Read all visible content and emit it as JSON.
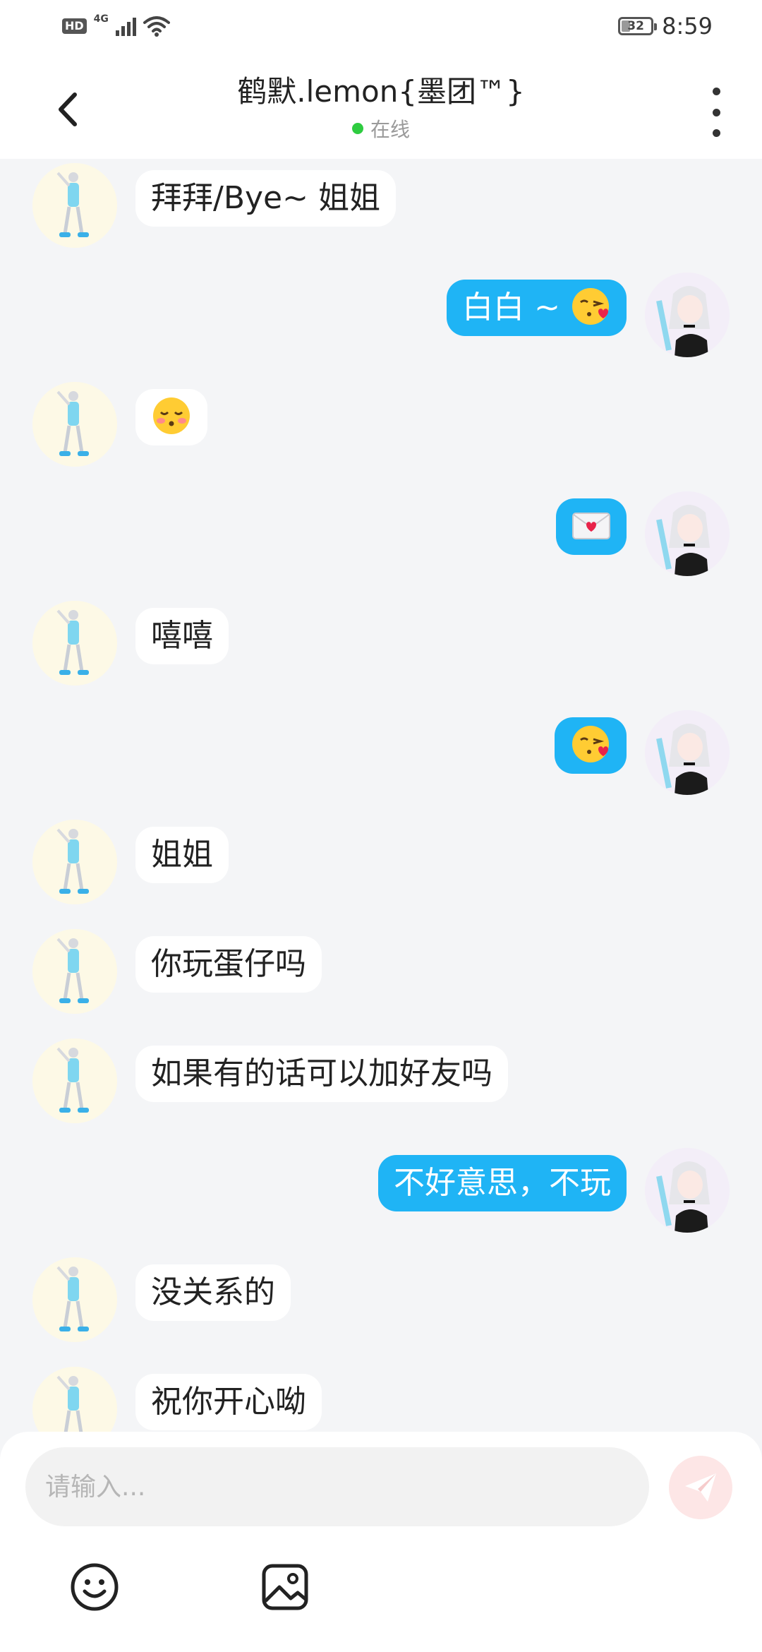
{
  "status_bar": {
    "hd": "HD",
    "network": "4G",
    "battery": "32",
    "time": "8:59"
  },
  "header": {
    "title": "鹤默.lemon{墨团™}",
    "status": "在线"
  },
  "messages": [
    {
      "side": "in",
      "text": "拜拜/Bye~ 姐姐"
    },
    {
      "side": "out",
      "text": "白白 ~",
      "emoji": "kissing-heart-emoji"
    },
    {
      "side": "in",
      "emoji": "kissing-closed-eyes-emoji"
    },
    {
      "side": "out",
      "emoji": "love-letter-emoji"
    },
    {
      "side": "in",
      "text": "嘻嘻"
    },
    {
      "side": "out",
      "emoji": "kissing-heart-emoji"
    },
    {
      "side": "in",
      "text": "姐姐"
    },
    {
      "side": "in",
      "text": "你玩蛋仔吗"
    },
    {
      "side": "in",
      "text": "如果有的话可以加好友吗"
    },
    {
      "side": "out",
      "text": "不好意思，不玩"
    },
    {
      "side": "in",
      "text": "没关系的"
    },
    {
      "side": "in",
      "text": "祝你开心呦"
    }
  ],
  "composer": {
    "placeholder": "请输入..."
  },
  "colors": {
    "outgoing_bubble": "#1fb4f5",
    "incoming_bubble": "#ffffff",
    "online_dot": "#2ecc40",
    "send_button": "#fde6e6"
  },
  "icons": {
    "back": "back-arrow-icon",
    "more": "more-vertical-icon",
    "send": "send-plane-icon",
    "emoji": "smiley-icon",
    "image": "image-icon"
  }
}
